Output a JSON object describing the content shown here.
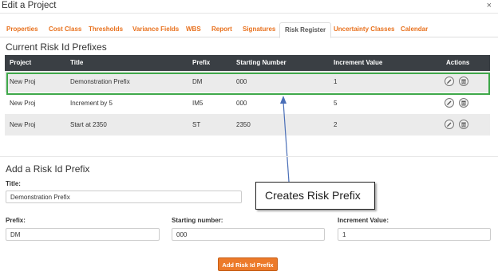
{
  "window": {
    "title": "Edit a Project",
    "close_glyph": "×"
  },
  "tabs": [
    {
      "label": "Properties",
      "active": false
    },
    {
      "label": "Cost Class",
      "active": false
    },
    {
      "label": "Thresholds",
      "active": false
    },
    {
      "label": "Variance Fields",
      "active": false
    },
    {
      "label": "WBS",
      "active": false
    },
    {
      "label": "Report",
      "active": false
    },
    {
      "label": "Signatures",
      "active": false
    },
    {
      "label": "Risk Register",
      "active": true
    },
    {
      "label": "Uncertainty Classes",
      "active": false
    },
    {
      "label": "Calendar",
      "active": false
    }
  ],
  "prefixes": {
    "heading": "Current Risk Id Prefixes",
    "columns": [
      "Project",
      "Title",
      "Prefix",
      "Starting Number",
      "Increment Value",
      "Actions"
    ],
    "rows": [
      {
        "project": "New Proj",
        "title": "Demonstration Prefix",
        "prefix": "DM",
        "start": "000",
        "increment": "1"
      },
      {
        "project": "New Proj",
        "title": "Increment by 5",
        "prefix": "IM5",
        "start": "000",
        "increment": "5"
      },
      {
        "project": "New Proj",
        "title": "Start at 2350",
        "prefix": "ST",
        "start": "2350",
        "increment": "2"
      }
    ],
    "action_icons": [
      "edit-icon",
      "delete-icon"
    ]
  },
  "form": {
    "heading": "Add a Risk Id Prefix",
    "title_label": "Title:",
    "title_value": "Demonstration Prefix",
    "prefix_label": "Prefix:",
    "prefix_value": "DM",
    "start_label": "Starting number:",
    "start_value": "000",
    "increment_label": "Increment Value:",
    "increment_value": "1",
    "submit_label": "Add Risk Id Prefix"
  },
  "annotation": {
    "callout_text": "Creates Risk Prefix"
  },
  "colors": {
    "accent": "#e8701c",
    "header_bg": "#3a3f44",
    "highlight": "#3fa84a",
    "arrow": "#4a6fb8",
    "button": "#ec7a2a"
  }
}
